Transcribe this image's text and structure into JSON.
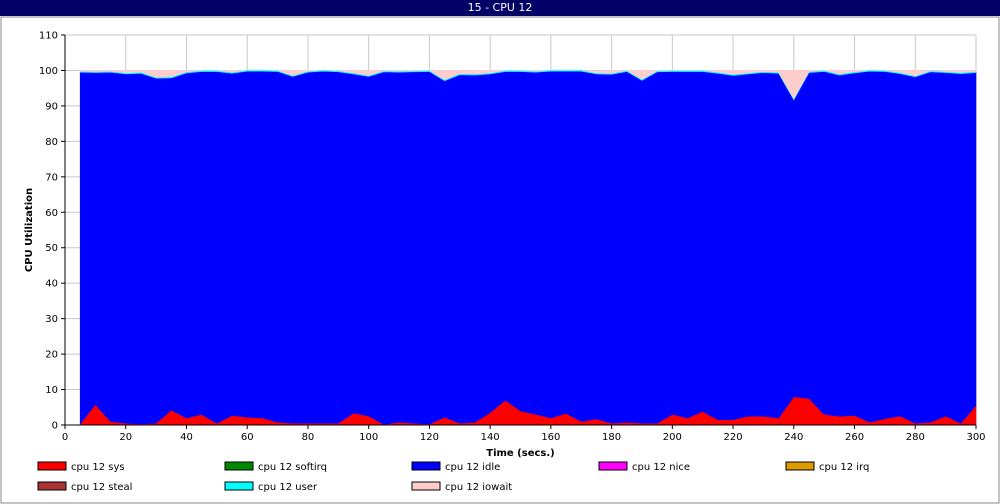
{
  "window": {
    "title": "15 - CPU 12"
  },
  "chart_data": {
    "type": "area",
    "stacked": true,
    "xlabel": "Time (secs.)",
    "ylabel": "CPU Utilization",
    "xlim": [
      0,
      300
    ],
    "ylim": [
      0,
      110
    ],
    "x_ticks": [
      0,
      20,
      40,
      60,
      80,
      100,
      120,
      140,
      160,
      180,
      200,
      220,
      240,
      260,
      280,
      300
    ],
    "y_ticks": [
      0,
      10,
      20,
      30,
      40,
      50,
      60,
      70,
      80,
      90,
      100,
      110
    ],
    "grid": true,
    "legend_position": "bottom",
    "x": [
      5,
      10,
      15,
      20,
      25,
      30,
      35,
      40,
      45,
      50,
      55,
      60,
      65,
      70,
      75,
      80,
      85,
      90,
      95,
      100,
      105,
      110,
      115,
      120,
      125,
      130,
      135,
      140,
      145,
      150,
      155,
      160,
      165,
      170,
      175,
      180,
      185,
      190,
      195,
      200,
      205,
      210,
      215,
      220,
      225,
      230,
      235,
      240,
      245,
      250,
      255,
      260,
      265,
      270,
      275,
      280,
      285,
      290,
      295,
      300
    ],
    "series": [
      {
        "name": "cpu 12 sys",
        "color": "#ff0000",
        "values": [
          0.3,
          5.8,
          1.0,
          0.5,
          0.3,
          0.5,
          4.2,
          2.0,
          3.0,
          0.5,
          2.7,
          2.2,
          2.0,
          0.8,
          0.5,
          0.5,
          0.5,
          0.5,
          3.4,
          2.5,
          0.2,
          0.8,
          0.5,
          0.3,
          2.2,
          0.5,
          0.8,
          3.5,
          7.0,
          4.0,
          3.0,
          2.0,
          3.3,
          1.0,
          1.7,
          0.5,
          0.8,
          0.5,
          0.5,
          3.0,
          2.0,
          3.8,
          1.5,
          1.5,
          2.5,
          2.5,
          2.0,
          8.0,
          7.5,
          3.0,
          2.5,
          2.7,
          0.8,
          1.8,
          2.5,
          0.5,
          0.8,
          2.5,
          0.5,
          5.5
        ]
      },
      {
        "name": "cpu 12 softirq",
        "color": "#008800",
        "values": [
          0,
          0,
          0,
          0,
          0,
          0,
          0,
          0,
          0,
          0,
          0,
          0,
          0,
          0,
          0,
          0,
          0,
          0,
          0,
          0,
          0,
          0,
          0,
          0,
          0,
          0,
          0,
          0,
          0,
          0,
          0,
          0,
          0,
          0,
          0,
          0,
          0,
          0,
          0,
          0,
          0,
          0,
          0,
          0,
          0,
          0,
          0,
          0,
          0,
          0,
          0,
          0,
          0,
          0,
          0,
          0,
          0,
          0,
          0,
          0
        ]
      },
      {
        "name": "cpu 12 idle",
        "color": "#0000ff",
        "values": [
          99.2,
          93.6,
          98.5,
          98.5,
          98.9,
          97.3,
          93.7,
          97.3,
          96.7,
          99.2,
          96.5,
          97.6,
          97.8,
          98.9,
          97.8,
          99.0,
          99.3,
          99.1,
          95.6,
          95.8,
          99.4,
          98.7,
          99.1,
          99.4,
          94.9,
          98.3,
          97.9,
          95.5,
          92.7,
          95.7,
          96.5,
          97.8,
          96.5,
          98.8,
          97.3,
          98.4,
          98.9,
          96.7,
          99.1,
          96.7,
          97.7,
          95.9,
          97.7,
          97.1,
          96.5,
          96.9,
          97.2,
          83.7,
          91.9,
          96.7,
          96.2,
          96.6,
          99.0,
          97.9,
          96.6,
          97.7,
          98.8,
          96.9,
          98.6,
          93.9
        ]
      },
      {
        "name": "cpu 12 nice",
        "color": "#ff00ff",
        "values": [
          0,
          0,
          0,
          0,
          0,
          0,
          0,
          0,
          0,
          0,
          0,
          0,
          0,
          0,
          0,
          0,
          0,
          0,
          0,
          0,
          0,
          0,
          0,
          0,
          0,
          0,
          0,
          0,
          0,
          0,
          0,
          0,
          0,
          0,
          0,
          0,
          0,
          0,
          0,
          0,
          0,
          0,
          0,
          0,
          0,
          0,
          0,
          0,
          0,
          0,
          0,
          0,
          0,
          0,
          0,
          0,
          0,
          0,
          0,
          0
        ]
      },
      {
        "name": "cpu 12 irq",
        "color": "#dd9900",
        "values": [
          0,
          0,
          0,
          0,
          0,
          0,
          0,
          0,
          0,
          0,
          0,
          0,
          0,
          0,
          0,
          0,
          0,
          0,
          0,
          0,
          0,
          0,
          0,
          0,
          0,
          0,
          0,
          0,
          0,
          0,
          0,
          0,
          0,
          0,
          0,
          0,
          0,
          0,
          0,
          0,
          0,
          0,
          0,
          0,
          0,
          0,
          0,
          0,
          0,
          0,
          0,
          0,
          0,
          0,
          0,
          0,
          0,
          0,
          0,
          0
        ]
      },
      {
        "name": "cpu 12 steal",
        "color": "#aa3333",
        "values": [
          0,
          0,
          0,
          0,
          0,
          0,
          0,
          0,
          0,
          0,
          0,
          0,
          0,
          0,
          0,
          0,
          0,
          0,
          0,
          0,
          0,
          0,
          0,
          0,
          0,
          0,
          0,
          0,
          0,
          0,
          0,
          0,
          0,
          0,
          0,
          0,
          0,
          0,
          0,
          0,
          0,
          0,
          0,
          0,
          0,
          0,
          0,
          0,
          0,
          0,
          0,
          0,
          0,
          0,
          0,
          0,
          0,
          0,
          0,
          0
        ]
      },
      {
        "name": "cpu 12 user",
        "color": "#00ffff",
        "values": [
          0.3,
          0.3,
          0.3,
          0.3,
          0.3,
          0.3,
          0.3,
          0.3,
          0.3,
          0.3,
          0.3,
          0.3,
          0.3,
          0.3,
          0.3,
          0.3,
          0.3,
          0.3,
          0.3,
          0.3,
          0.3,
          0.3,
          0.3,
          0.3,
          0.3,
          0.3,
          0.3,
          0.3,
          0.3,
          0.3,
          0.3,
          0.3,
          0.3,
          0.3,
          0.3,
          0.3,
          0.3,
          0.3,
          0.3,
          0.3,
          0.3,
          0.3,
          0.3,
          0.3,
          0.3,
          0.3,
          0.3,
          0.3,
          0.3,
          0.3,
          0.3,
          0.3,
          0.3,
          0.3,
          0.3,
          0.3,
          0.3,
          0.3,
          0.3,
          0.3
        ]
      },
      {
        "name": "cpu 12 iowait",
        "color": "#ffcccc",
        "values": [
          0.2,
          0.3,
          0.2,
          0.7,
          0.5,
          1.9,
          1.8,
          0.4,
          0,
          0,
          0.5,
          0,
          0,
          0,
          1.4,
          0.2,
          0,
          0.1,
          0.7,
          1.4,
          0.1,
          0.2,
          0.1,
          0,
          2.6,
          0.9,
          1.0,
          0.7,
          0,
          0,
          0.2,
          0,
          0,
          0,
          0.5,
          0.8,
          0,
          2.5,
          0.1,
          0,
          0,
          0,
          0.5,
          1.1,
          0.7,
          0.3,
          0.5,
          8.0,
          0.3,
          0,
          1.0,
          0.4,
          0,
          0,
          0.6,
          1.5,
          0,
          0.3,
          0.6,
          0.3
        ]
      }
    ]
  }
}
